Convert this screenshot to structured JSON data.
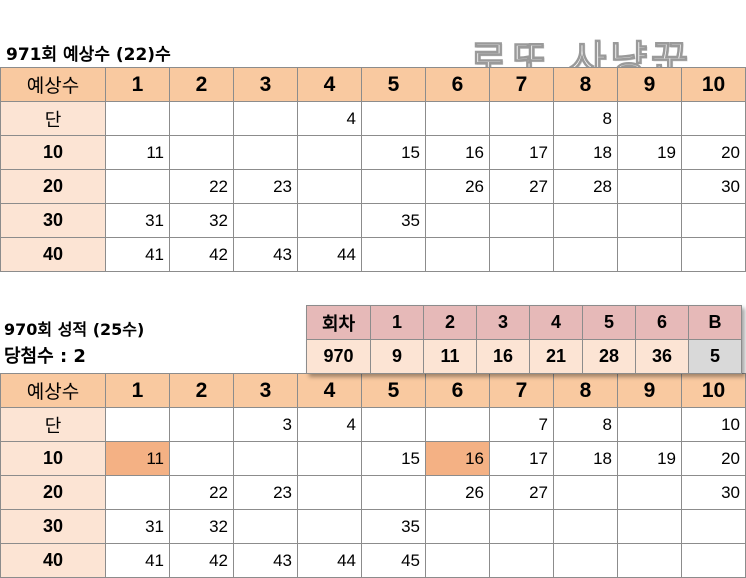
{
  "brand": "로또 사냥꾼",
  "pred": {
    "title": "971회 예상수 (22)수",
    "corner": "예상수",
    "cols": [
      "1",
      "2",
      "3",
      "4",
      "5",
      "6",
      "7",
      "8",
      "9",
      "10"
    ],
    "rows": [
      {
        "label": "단",
        "cells": [
          "",
          "",
          "",
          "4",
          "",
          "",
          "",
          "8",
          "",
          ""
        ]
      },
      {
        "label": "10",
        "cells": [
          "11",
          "",
          "",
          "",
          "15",
          "16",
          "17",
          "18",
          "19",
          "20"
        ]
      },
      {
        "label": "20",
        "cells": [
          "",
          "22",
          "23",
          "",
          "",
          "26",
          "27",
          "28",
          "",
          "30"
        ]
      },
      {
        "label": "30",
        "cells": [
          "31",
          "32",
          "",
          "",
          "35",
          "",
          "",
          "",
          "",
          ""
        ]
      },
      {
        "label": "40",
        "cells": [
          "41",
          "42",
          "43",
          "44",
          "",
          "",
          "",
          "",
          "",
          ""
        ]
      }
    ]
  },
  "result": {
    "title": "970회 성적 (25수)",
    "hits": "당첨수 :  2",
    "corner": "예상수",
    "cols": [
      "1",
      "2",
      "3",
      "4",
      "5",
      "6",
      "7",
      "8",
      "9",
      "10"
    ],
    "rows": [
      {
        "label": "단",
        "cells": [
          "",
          "",
          "3",
          "4",
          "",
          "",
          "7",
          "8",
          "",
          "10"
        ]
      },
      {
        "label": "10",
        "cells": [
          "11",
          "",
          "",
          "",
          "15",
          "16",
          "17",
          "18",
          "19",
          "20"
        ]
      },
      {
        "label": "20",
        "cells": [
          "",
          "22",
          "23",
          "",
          "",
          "26",
          "27",
          "",
          "",
          "30"
        ]
      },
      {
        "label": "30",
        "cells": [
          "31",
          "32",
          "",
          "",
          "35",
          "",
          "",
          "",
          "",
          ""
        ]
      },
      {
        "label": "40",
        "cells": [
          "41",
          "42",
          "43",
          "44",
          "45",
          "",
          "",
          "",
          "",
          ""
        ]
      }
    ],
    "highlighted": [
      "11",
      "16"
    ],
    "highlight_color": "#f4b184"
  },
  "winning": {
    "headers": [
      "회차",
      "1",
      "2",
      "3",
      "4",
      "5",
      "6",
      "B"
    ],
    "values": [
      "970",
      "9",
      "11",
      "16",
      "21",
      "28",
      "36",
      "5"
    ]
  }
}
